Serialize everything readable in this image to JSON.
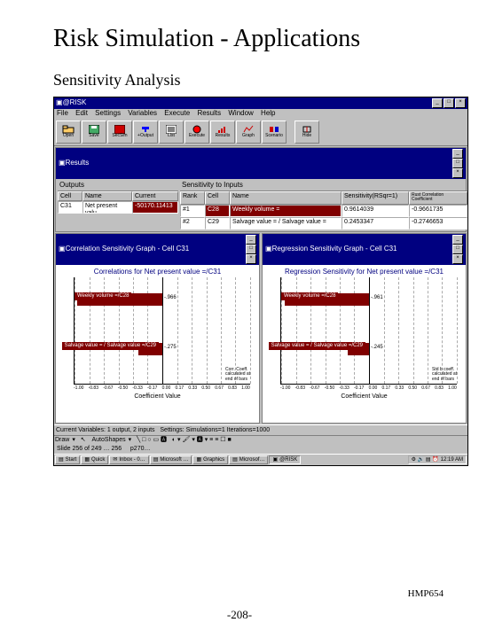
{
  "slide": {
    "title": "Risk Simulation - Applications",
    "subtitle": "Sensitivity Analysis",
    "footer_right": "HMP654",
    "footer_center": "-208-"
  },
  "app": {
    "title": "@RISK",
    "menu": [
      "File",
      "Edit",
      "Settings",
      "Variables",
      "Execute",
      "Results",
      "Window",
      "Help"
    ],
    "toolbar": [
      {
        "name": "open",
        "label": "Open"
      },
      {
        "name": "save",
        "label": "Save"
      },
      {
        "name": "secsim",
        "label": "SecSim"
      },
      {
        "name": "output",
        "label": "+Output"
      },
      {
        "name": "list",
        "label": "List"
      },
      {
        "name": "execute",
        "label": "Execute"
      },
      {
        "name": "results",
        "label": "Results"
      },
      {
        "name": "graph",
        "label": "Graph"
      },
      {
        "name": "scenario",
        "label": "Scenario"
      },
      {
        "name": "hide",
        "label": "Hide"
      }
    ]
  },
  "results": {
    "title": "Results",
    "outputs_header": "Outputs",
    "sensitivity_header": "Sensitivity to Inputs",
    "output_cols": [
      "Cell",
      "Name",
      "Current"
    ],
    "input_cols": [
      "Rank",
      "Cell",
      "Name",
      "Sensitivity(RSqr=1)",
      "Rust Correlation Coefficient"
    ],
    "output_row": {
      "cell": "C31",
      "name": "Net present valu",
      "current": "-50170.11413"
    },
    "input_rows": [
      {
        "rank": "#1",
        "cell": "C28",
        "name": "Weekly volume =",
        "rsqr": "0.9614039",
        "corr": "-0.9661735"
      },
      {
        "rank": "#2",
        "cell": "C29",
        "name": "Salvage value = / Salvage value =",
        "rsqr": "0.2453347",
        "corr": "-0.2746653"
      }
    ]
  },
  "chart_data": [
    {
      "type": "bar",
      "window_title": "Correlation Sensitivity Graph - Cell C31",
      "title": "Correlations for Net present value =/C31",
      "xlabel": "Coefficient Value",
      "xlim": [
        -1.0,
        1.0
      ],
      "xticks": [
        -1.0,
        -0.83,
        -0.67,
        -0.5,
        -0.33,
        -0.17,
        0.0,
        0.17,
        0.33,
        0.5,
        0.67,
        0.83,
        1.0
      ],
      "axis_note": "Corr. Coeff. calculated at end of bars",
      "series": [
        {
          "name": "Weekly volume =/C28",
          "value": -0.966
        },
        {
          "name": "Salvage value = / Salvage value =/C29",
          "value": -0.275
        }
      ]
    },
    {
      "type": "bar",
      "window_title": "Regression Sensitivity Graph - Cell C31",
      "title": "Regression Sensitivity for Net present value =/C31",
      "xlabel": "Coefficient Value",
      "xlim": [
        -1.0,
        1.0
      ],
      "xticks": [
        -1.0,
        -0.83,
        -0.67,
        -0.5,
        -0.33,
        -0.17,
        0.0,
        0.17,
        0.33,
        0.5,
        0.67,
        0.83,
        1.0
      ],
      "axis_note": "Std b coeff. calculated at end of bars",
      "series": [
        {
          "name": "Weekly volume =/C28",
          "value": -0.961
        },
        {
          "name": "Salvage value = / Salvage value =/C29",
          "value": -0.245
        }
      ]
    }
  ],
  "statusbar": {
    "vars": "Current Variables: 1 output, 2 inputs",
    "settings": "Settings:  Simulations=1  Iterations=1000"
  },
  "drawbar": {
    "label": "Draw",
    "shapes": "AutoShapes"
  },
  "slidebar": {
    "text": "Slide 256 of 249 … 256",
    "file": "p270…"
  },
  "taskbar": {
    "start": "Start",
    "items": [
      "Quick",
      "Inbox - 0…",
      "Microsoft …",
      "Graphics",
      "Microsof…",
      "@RISK"
    ],
    "time": "12:19 AM"
  }
}
